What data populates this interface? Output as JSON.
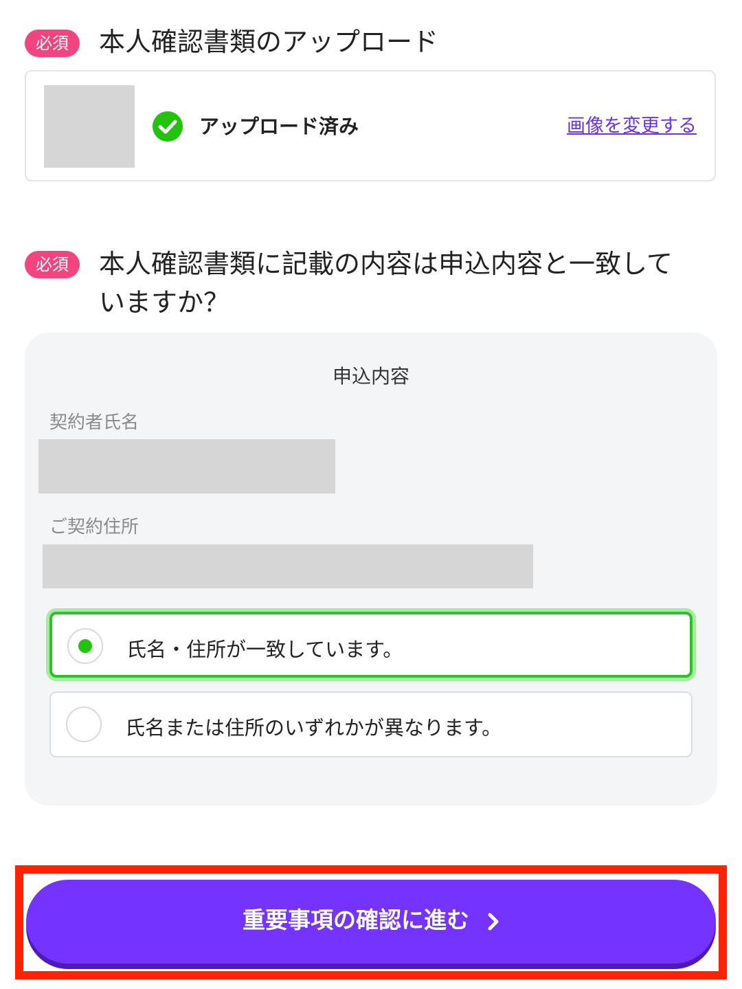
{
  "upload_section": {
    "badge": "必須",
    "title": "本人確認書類のアップロード",
    "status": "アップロード済み",
    "change_link": "画像を変更する"
  },
  "confirm_section": {
    "badge": "必須",
    "title_line1": "本人確認書類に記載の内容は申込内容と一致して",
    "title_line2": "いますか？",
    "panel_heading": "申込内容",
    "name_label": "契約者氏名",
    "address_label": "ご契約住所",
    "options": [
      {
        "label": "氏名・住所が一致しています。",
        "selected": true
      },
      {
        "label": "氏名または住所のいずれかが異なります。",
        "selected": false
      }
    ]
  },
  "cta": {
    "label": "重要事項の確認に進む",
    "icon": "chevron-right-icon"
  },
  "colors": {
    "badge": "#f2457f",
    "accent_purple": "#7433ff",
    "link": "#6a32e8",
    "success_green": "#22c20f",
    "highlight_red": "#ff2200"
  }
}
